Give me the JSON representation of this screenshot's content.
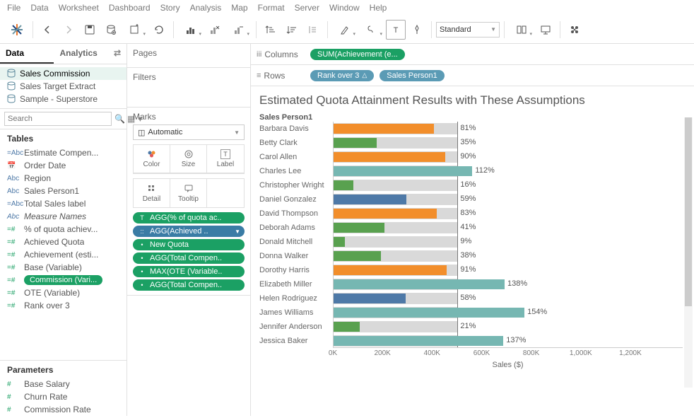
{
  "menu": [
    "File",
    "Data",
    "Worksheet",
    "Dashboard",
    "Story",
    "Analysis",
    "Map",
    "Format",
    "Server",
    "Window",
    "Help"
  ],
  "toolbar": {
    "fit": "Standard"
  },
  "data_panel": {
    "tabs": {
      "data": "Data",
      "analytics": "Analytics"
    },
    "sources": [
      "Sales Commission",
      "Sales Target Extract",
      "Sample - Superstore"
    ],
    "search_placeholder": "Search",
    "tables_hdr": "Tables",
    "params_hdr": "Parameters",
    "dims": [
      {
        "icon": "=Abc",
        "label": "Estimate Compen..."
      },
      {
        "icon": "📅",
        "label": "Order Date"
      },
      {
        "icon": "Abc",
        "label": "Region"
      },
      {
        "icon": "Abc",
        "label": "Sales Person1"
      },
      {
        "icon": "=Abc",
        "label": "Total Sales label"
      },
      {
        "icon": "Abc",
        "label": "Measure Names",
        "italic": true
      }
    ],
    "meas": [
      {
        "icon": "=#",
        "label": "% of quota achiev..."
      },
      {
        "icon": "=#",
        "label": "Achieved Quota"
      },
      {
        "icon": "=#",
        "label": "Achievement (esti..."
      },
      {
        "icon": "=#",
        "label": "Base (Variable)"
      },
      {
        "icon": "=#",
        "label": "Commission (Vari...",
        "pill": true
      },
      {
        "icon": "=#",
        "label": "OTE (Variable)"
      },
      {
        "icon": "=#",
        "label": "Rank over 3"
      }
    ],
    "params": [
      {
        "icon": "#",
        "label": "Base Salary"
      },
      {
        "icon": "#",
        "label": "Churn Rate"
      },
      {
        "icon": "#",
        "label": "Commission Rate"
      }
    ]
  },
  "shelves": {
    "pages": "Pages",
    "filters": "Filters",
    "marks": "Marks",
    "mark_type": "Automatic",
    "mark_btns": [
      "Color",
      "Size",
      "Label",
      "Detail",
      "Tooltip"
    ],
    "mark_pills": [
      {
        "icon": "T",
        "label": "AGG(% of quota ac..",
        "sel": false
      },
      {
        "icon": "::",
        "label": "AGG(Achieved ..",
        "sel": true
      },
      {
        "icon": "•",
        "label": "New Quota",
        "sel": false
      },
      {
        "icon": "•",
        "label": "AGG(Total Compen..",
        "sel": false
      },
      {
        "icon": "•",
        "label": "MAX(OTE (Variable..",
        "sel": false
      },
      {
        "icon": "•",
        "label": "AGG(Total Compen..",
        "sel": false
      }
    ],
    "columns": "Columns",
    "rows": "Rows",
    "col_pill": "SUM(Achievement (e...",
    "row_pills": [
      "Rank over 3",
      "Sales Person1"
    ]
  },
  "chart_data": {
    "type": "bar",
    "title": "Estimated Quota Attainment Results with These Assumptions",
    "row_header": "Sales Person1",
    "xlabel": "Sales ($)",
    "xlim": [
      0,
      1300000
    ],
    "xticks": [
      0,
      200000,
      400000,
      600000,
      800000,
      1000000,
      1200000
    ],
    "xtick_labels": [
      "0K",
      "200K",
      "400K",
      "600K",
      "800K",
      "1,000K",
      "1,200K"
    ],
    "reference_line": 500000,
    "series": [
      {
        "name": "Barbara Davis",
        "quota_pct": 81,
        "sales": 405000,
        "ref_band": 500000,
        "color": "orange"
      },
      {
        "name": "Betty Clark",
        "quota_pct": 35,
        "sales": 175000,
        "ref_band": 500000,
        "color": "green"
      },
      {
        "name": "Carol Allen",
        "quota_pct": 90,
        "sales": 450000,
        "ref_band": 500000,
        "color": "orange"
      },
      {
        "name": "Charles Lee",
        "quota_pct": 112,
        "sales": 560000,
        "ref_band": 500000,
        "color": "teal"
      },
      {
        "name": "Christopher Wright",
        "quota_pct": 16,
        "sales": 80000,
        "ref_band": 500000,
        "color": "green"
      },
      {
        "name": "Daniel Gonzalez",
        "quota_pct": 59,
        "sales": 295000,
        "ref_band": 500000,
        "color": "blue"
      },
      {
        "name": "David Thompson",
        "quota_pct": 83,
        "sales": 415000,
        "ref_band": 500000,
        "color": "orange"
      },
      {
        "name": "Deborah Adams",
        "quota_pct": 41,
        "sales": 205000,
        "ref_band": 500000,
        "color": "green"
      },
      {
        "name": "Donald Mitchell",
        "quota_pct": 9,
        "sales": 45000,
        "ref_band": 500000,
        "color": "green"
      },
      {
        "name": "Donna Walker",
        "quota_pct": 38,
        "sales": 190000,
        "ref_band": 500000,
        "color": "green"
      },
      {
        "name": "Dorothy Harris",
        "quota_pct": 91,
        "sales": 455000,
        "ref_band": 500000,
        "color": "orange"
      },
      {
        "name": "Elizabeth Miller",
        "quota_pct": 138,
        "sales": 690000,
        "ref_band": 500000,
        "color": "teal"
      },
      {
        "name": "Helen Rodriguez",
        "quota_pct": 58,
        "sales": 290000,
        "ref_band": 500000,
        "color": "blue"
      },
      {
        "name": "James Williams",
        "quota_pct": 154,
        "sales": 770000,
        "ref_band": 500000,
        "color": "teal"
      },
      {
        "name": "Jennifer Anderson",
        "quota_pct": 21,
        "sales": 105000,
        "ref_band": 500000,
        "color": "green"
      },
      {
        "name": "Jessica Baker",
        "quota_pct": 137,
        "sales": 685000,
        "ref_band": 500000,
        "color": "teal"
      }
    ]
  }
}
